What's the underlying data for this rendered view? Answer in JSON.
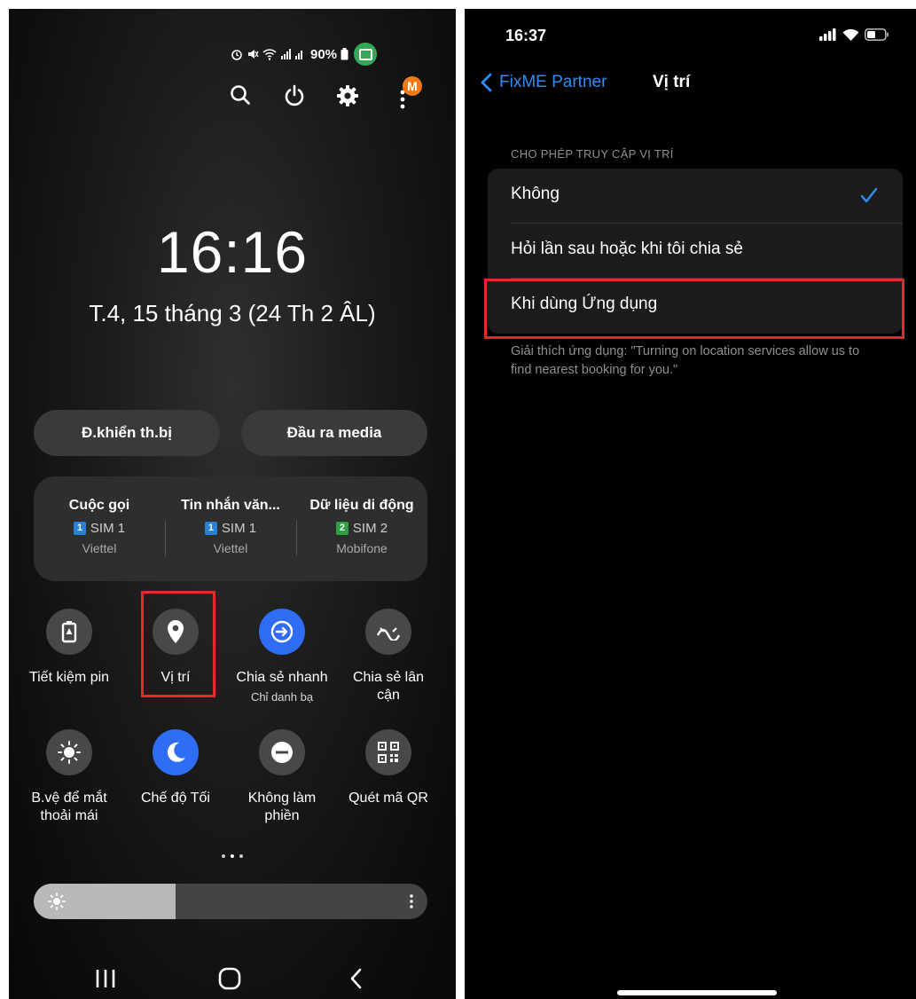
{
  "android": {
    "status_bar": {
      "battery_percent": "90%"
    },
    "quick_actions": [
      "search-icon",
      "power-icon",
      "settings-icon",
      "more-icon"
    ],
    "avatar_letter": "M",
    "clock": "16:16",
    "date": "T.4, 15 tháng 3 (24 Th 2 ÂL)",
    "pills": {
      "device_control": "Đ.khiển th.bị",
      "media_output": "Đầu ra media"
    },
    "sim_panel": [
      {
        "title": "Cuộc gọi",
        "sim_number": "1",
        "sim_label": "SIM 1",
        "carrier": "Viettel",
        "badge_color": "#2a7fd6"
      },
      {
        "title": "Tin nhắn văn...",
        "sim_number": "1",
        "sim_label": "SIM 1",
        "carrier": "Viettel",
        "badge_color": "#2a7fd6"
      },
      {
        "title": "Dữ liệu di động",
        "sim_number": "2",
        "sim_label": "SIM 2",
        "carrier": "Mobifone",
        "badge_color": "#2ea043"
      }
    ],
    "tiles_row1": [
      {
        "label": "Tiết kiệm pin",
        "icon": "battery-saver-icon",
        "active": false
      },
      {
        "label": "Vị trí",
        "icon": "location-icon",
        "active": false,
        "highlighted": true
      },
      {
        "label": "Chia sẻ nhanh",
        "sublabel": "Chỉ danh bạ",
        "icon": "quick-share-icon",
        "active": true
      },
      {
        "label": "Chia sẻ lân cận",
        "icon": "nearby-share-icon",
        "active": false
      }
    ],
    "tiles_row2": [
      {
        "label": "B.vệ để mắt thoải mái",
        "icon": "eye-comfort-icon",
        "active": false
      },
      {
        "label": "Chế độ Tối",
        "icon": "dark-mode-icon",
        "active": true
      },
      {
        "label": "Không làm phiền",
        "icon": "do-not-disturb-icon",
        "active": false
      },
      {
        "label": "Quét mã QR",
        "icon": "qr-code-icon",
        "active": false
      }
    ],
    "page_indicator": {
      "pages": 3,
      "current": 1
    },
    "brightness_level": 0.36,
    "nav_buttons": [
      "recents-button",
      "home-button",
      "back-button"
    ]
  },
  "ios": {
    "time": "16:37",
    "back_label": "FixME Partner",
    "title": "Vị trí",
    "section_header": "CHO PHÉP TRUY CẬP VỊ TRÍ",
    "options": [
      {
        "label": "Không",
        "selected": true
      },
      {
        "label": "Hỏi lần sau hoặc khi tôi chia sẻ",
        "selected": false
      },
      {
        "label": "Khi dùng Ứng dụng",
        "selected": false,
        "highlighted": true
      }
    ],
    "note": "Giải thích ứng dụng: \"Turning on location services allow us to find nearest booking for you.\""
  },
  "colors": {
    "accent_blue": "#2f6df5",
    "ios_blue": "#2f8ef5",
    "highlight_red": "#e32b2b",
    "avatar_orange": "#f07a1a"
  }
}
